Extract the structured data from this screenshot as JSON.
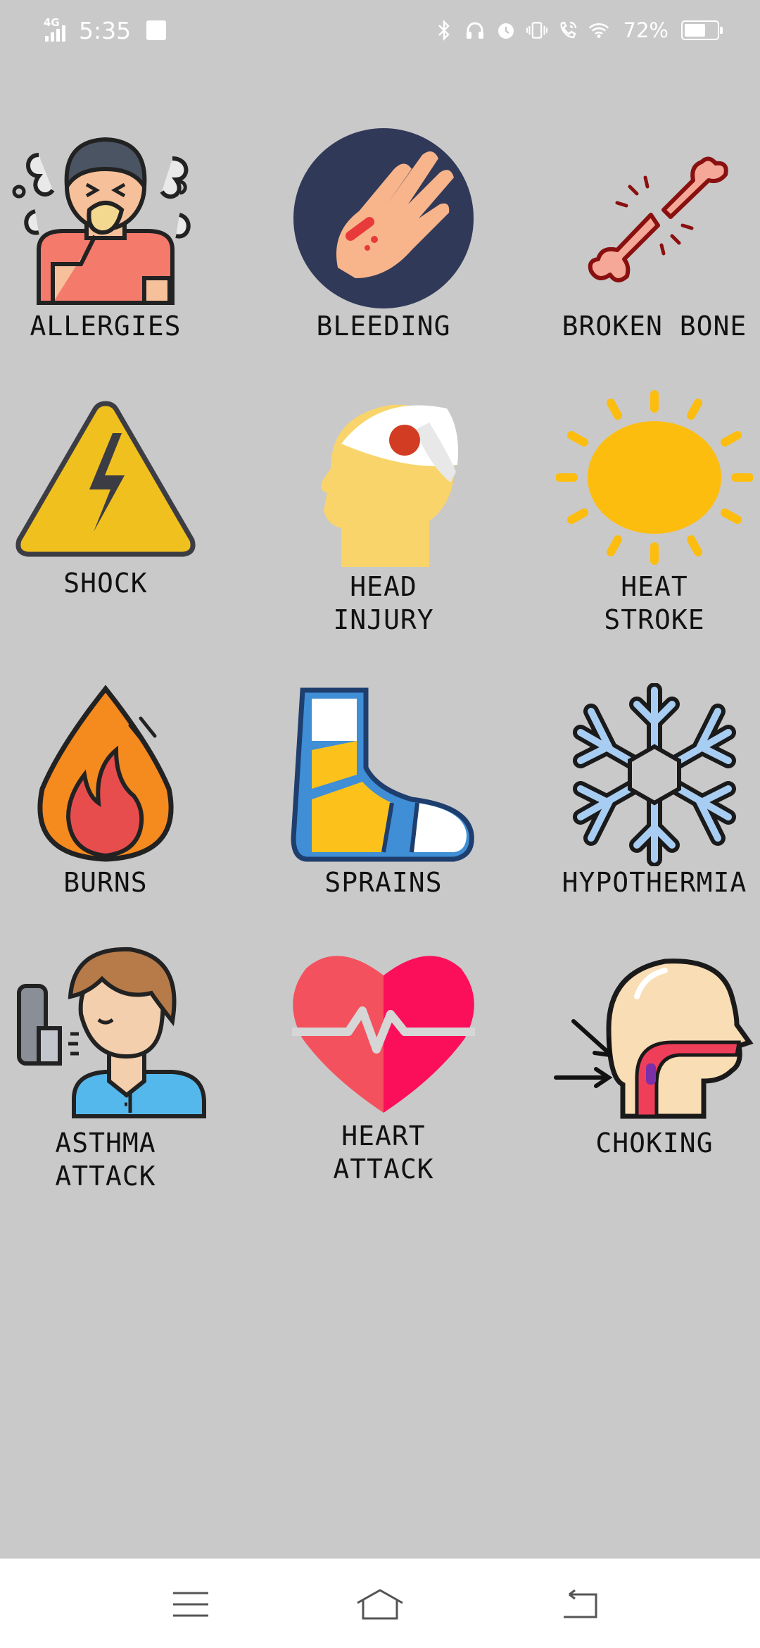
{
  "status_bar": {
    "network": "4G",
    "time": "5:35",
    "battery": "72%",
    "battery_level": 0.72,
    "icons": [
      "bluetooth-icon",
      "headphones-icon",
      "alarm-icon",
      "vibrate-icon",
      "wifi-calling-icon",
      "wifi-icon"
    ]
  },
  "grid": {
    "items": [
      {
        "label": "ALLERGIES",
        "icon": "allergies-icon"
      },
      {
        "label": "BLEEDING",
        "icon": "bleeding-hand-icon"
      },
      {
        "label": "BROKEN BONE",
        "icon": "broken-bone-icon"
      },
      {
        "label": "SHOCK",
        "icon": "electric-shock-icon"
      },
      {
        "label": "HEAD\nINJURY",
        "icon": "head-injury-icon"
      },
      {
        "label": "HEAT\nSTROKE",
        "icon": "sun-icon"
      },
      {
        "label": "BURNS",
        "icon": "fire-drop-icon"
      },
      {
        "label": "SPRAINS",
        "icon": "bandaged-foot-icon"
      },
      {
        "label": "HYPOTHERMIA",
        "icon": "snowflake-icon"
      },
      {
        "label": "ASTHMA\nATTACK",
        "icon": "inhaler-person-icon"
      },
      {
        "label": "HEART\nATTACK",
        "icon": "heartbeat-icon"
      },
      {
        "label": "CHOKING",
        "icon": "throat-icon"
      }
    ]
  },
  "nav_bar": {
    "icons": [
      "menu-icon",
      "home-icon",
      "back-icon"
    ]
  },
  "colors": {
    "background": "#c9c9c9",
    "nav_background": "#ffffff"
  }
}
